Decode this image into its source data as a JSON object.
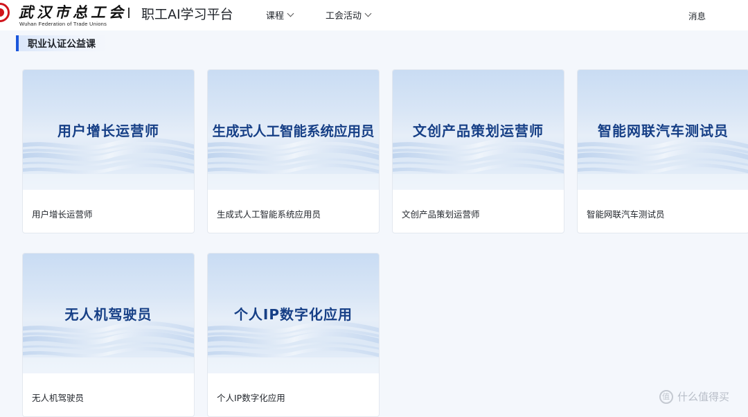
{
  "header": {
    "logo_cn": "武汉市总工会",
    "logo_en": "Wuhan Federation of Trade Unions",
    "platform_title": "职工AI学习平台",
    "nav": [
      {
        "label": "课程"
      },
      {
        "label": "工会活动"
      }
    ],
    "messages_label": "消息"
  },
  "section": {
    "title": "职业认证公益课"
  },
  "courses": [
    {
      "cover_title": "用户增长运营师",
      "label": "用户增长运营师"
    },
    {
      "cover_title": "生成式人工智能系统应用员",
      "label": "生成式人工智能系统应用员"
    },
    {
      "cover_title": "文创产品策划运营师",
      "label": "文创产品策划运营师"
    },
    {
      "cover_title": "智能网联汽车测试员",
      "label": "智能网联汽车测试员"
    },
    {
      "cover_title": "无人机驾驶员",
      "label": "无人机驾驶员"
    },
    {
      "cover_title": "个人IP数字化应用",
      "label": "个人IP数字化应用"
    }
  ],
  "watermark": {
    "text": "什么值得买"
  },
  "colors": {
    "brand_red": "#d0141b",
    "accent_blue": "#1a56db",
    "cover_title_blue": "#163f86"
  }
}
